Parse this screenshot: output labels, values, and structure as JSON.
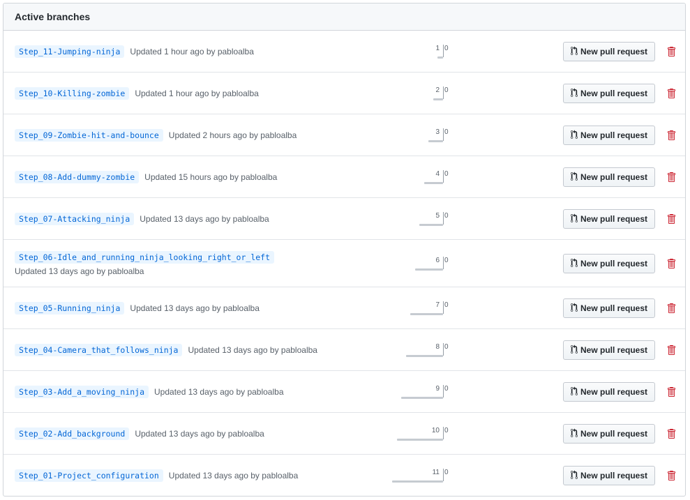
{
  "header": {
    "title": "Active branches"
  },
  "pr_button_label": "New pull request",
  "colors": {
    "link": "#0366d6",
    "delete": "#cb2431",
    "bar": "#c6cbd1"
  },
  "icons": {
    "pr": "git-pull-request-icon",
    "delete": "trashcan-icon"
  },
  "branches": [
    {
      "name": "Step_11-Jumping-ninja",
      "updated": "Updated 1 hour ago by pabloalba",
      "behind": "1",
      "ahead": "0"
    },
    {
      "name": "Step_10-Killing-zombie",
      "updated": "Updated 1 hour ago by pabloalba",
      "behind": "2",
      "ahead": "0"
    },
    {
      "name": "Step_09-Zombie-hit-and-bounce",
      "updated": "Updated 2 hours ago by pabloalba",
      "behind": "3",
      "ahead": "0"
    },
    {
      "name": "Step_08-Add-dummy-zombie",
      "updated": "Updated 15 hours ago by pabloalba",
      "behind": "4",
      "ahead": "0"
    },
    {
      "name": "Step_07-Attacking_ninja",
      "updated": "Updated 13 days ago by pabloalba",
      "behind": "5",
      "ahead": "0"
    },
    {
      "name": "Step_06-Idle_and_running_ninja_looking_right_or_left",
      "updated": "Updated 13 days ago by pabloalba",
      "behind": "6",
      "ahead": "0"
    },
    {
      "name": "Step_05-Running_ninja",
      "updated": "Updated 13 days ago by pabloalba",
      "behind": "7",
      "ahead": "0"
    },
    {
      "name": "Step_04-Camera_that_follows_ninja",
      "updated": "Updated 13 days ago by pabloalba",
      "behind": "8",
      "ahead": "0"
    },
    {
      "name": "Step_03-Add_a_moving_ninja",
      "updated": "Updated 13 days ago by pabloalba",
      "behind": "9",
      "ahead": "0"
    },
    {
      "name": "Step_02-Add_background",
      "updated": "Updated 13 days ago by pabloalba",
      "behind": "10",
      "ahead": "0"
    },
    {
      "name": "Step_01-Project_configuration",
      "updated": "Updated 13 days ago by pabloalba",
      "behind": "11",
      "ahead": "0"
    }
  ]
}
